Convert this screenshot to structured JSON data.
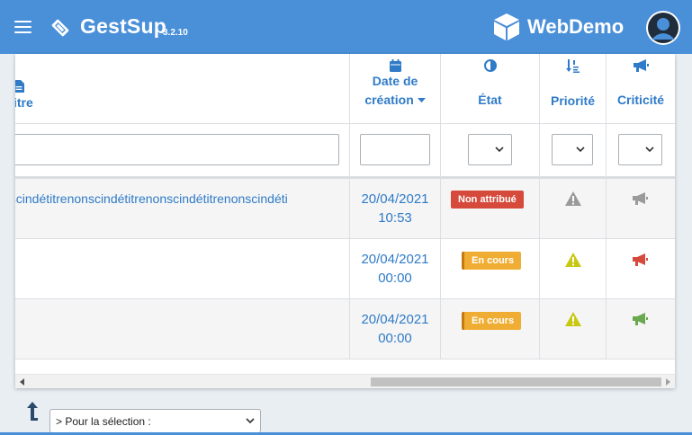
{
  "navbar": {
    "brand": "GestSup",
    "version": "3.2.10",
    "company": "WebDemo",
    "menu_icon": "hamburger-icon",
    "logo_icon": "ticket-icon",
    "company_icon": "cube-icon",
    "user_icon": "user-avatar-icon",
    "bg_color": "#4a90d9"
  },
  "table": {
    "columns": [
      {
        "key": "title",
        "label": "itre",
        "icon": "file-icon"
      },
      {
        "key": "date",
        "label_line1": "Date de",
        "label_line2": "création",
        "icon": "calendar-icon",
        "sort": "desc"
      },
      {
        "key": "state",
        "label": "État",
        "icon": "half-circle-icon"
      },
      {
        "key": "priority",
        "label": "Priorité",
        "icon": "sort-numeric-down-icon"
      },
      {
        "key": "criticality",
        "label": "Criticité",
        "icon": "megaphone-icon"
      }
    ],
    "filters": {
      "title_value": "",
      "date_value": "",
      "state_value": "",
      "priority_value": "",
      "criticality_value": ""
    },
    "rows": [
      {
        "title": "nscindétitrenonscindétitrenonscindétitrenonscindéti",
        "date_line1": "20/04/2021",
        "date_line2": "10:53",
        "state": "Non attribué",
        "state_color": "#d64a3b",
        "priority_icon": "warning-icon",
        "priority_color": "#9a9a9a",
        "criticality_icon": "megaphone-icon",
        "criticality_color": "#9a9a9a"
      },
      {
        "title": "",
        "date_line1": "20/04/2021",
        "date_line2": "00:00",
        "state": "En cours",
        "state_color": "#f0ad33",
        "priority_icon": "warning-icon",
        "priority_color": "#c8c812",
        "criticality_icon": "megaphone-icon",
        "criticality_color": "#d64a3b"
      },
      {
        "title": "",
        "date_line1": "20/04/2021",
        "date_line2": "00:00",
        "state": "En cours",
        "state_color": "#f0ad33",
        "priority_icon": "warning-icon",
        "priority_color": "#c8c812",
        "criticality_icon": "megaphone-icon",
        "criticality_color": "#6aa84f"
      }
    ]
  },
  "bulk": {
    "select_label": "> Pour la sélection :",
    "arrow_icon": "arrow-up-icon"
  }
}
